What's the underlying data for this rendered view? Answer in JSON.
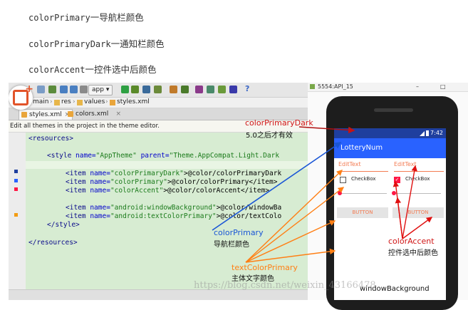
{
  "intro": [
    {
      "code": "colorPrimary",
      "zh": "一导航栏颜色"
    },
    {
      "code": "colorPrimaryDark",
      "zh": "一通知栏颜色"
    },
    {
      "code": "colorAccent",
      "zh": "一控件选中后颜色"
    }
  ],
  "ide": {
    "toolbar": {
      "run_config": "app"
    },
    "breadcrumb": [
      "main",
      "res",
      "values",
      "styles.xml"
    ],
    "tabs": [
      {
        "label": "styles.xml",
        "active": true
      },
      {
        "label": "colors.xml",
        "active": false
      }
    ],
    "notice": "Edit all themes in the project in the theme editor.",
    "code": {
      "resources_open": "<resources>",
      "style_open_tag": "<style ",
      "style_name_attr": "name=",
      "style_name_val": "\"AppTheme\"",
      "style_parent_attr": " parent=",
      "style_parent_val": "\"Theme.AppCompat.Light.Dark",
      "items": [
        {
          "name": "\"colorPrimaryDark\"",
          "value": ">@color/colorPrimaryDark"
        },
        {
          "name": "\"colorPrimary\"",
          "value": ">@color/colorPrimary</item>"
        },
        {
          "name": "\"colorAccent\"",
          "value": ">@color/colorAccent</item>"
        },
        {
          "name": "\"android:windowBackground\"",
          "value": ">@color/windowBa"
        },
        {
          "name": "\"android:textColorPrimary\"",
          "value": ">@color/textColo"
        }
      ],
      "item_open": "<item ",
      "item_name_attr": "name=",
      "style_close": "</style>",
      "resources_close": "</resources>"
    }
  },
  "emulator": {
    "title": "5554:API_15",
    "status_time": "7:42",
    "app_title": "LotteryNum",
    "edittext_1": "EditText",
    "edittext_2": "EditText",
    "checkbox_1": "CheckBox",
    "checkbox_2": "CheckBox",
    "checkbox_2_checked": true,
    "button_1": "BUTTON",
    "button_2": "BUTTON",
    "window_background_label": "windowBackground"
  },
  "annotations": {
    "primary_dark": "colorPrimaryDark",
    "primary_dark_desc": "5.0之后才有效",
    "primary": "colorPrimary",
    "primary_desc": "导航栏颜色",
    "accent": "colorAccent",
    "accent_desc": "控件选中后颜色",
    "text_primary": "textColorPrimary",
    "text_primary_desc": "主体文字颜色"
  },
  "watermark": "https://blog.csdn.net/weixin_43166478",
  "colors": {
    "primary": "#2962ff",
    "primary_dark": "#1f3f9e",
    "accent": "#ff1744",
    "text_primary": "#f37b52",
    "annotation_red": "#d01515",
    "annotation_blue": "#1a56d6",
    "annotation_orange": "#ff7f14"
  }
}
